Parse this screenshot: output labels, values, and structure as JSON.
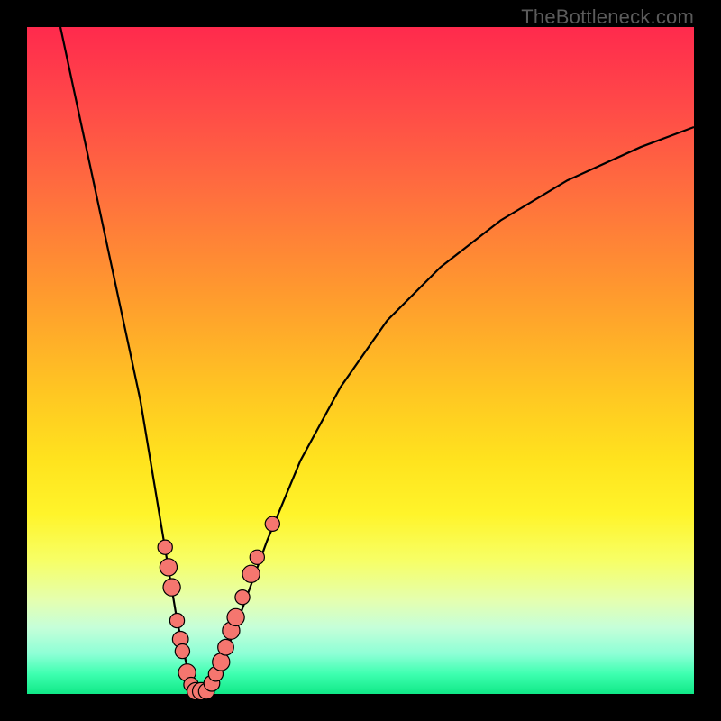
{
  "watermark": "TheBottleneck.com",
  "chart_data": {
    "type": "line",
    "title": "",
    "xlabel": "",
    "ylabel": "",
    "xlim": [
      0,
      100
    ],
    "ylim": [
      0,
      100
    ],
    "series": [
      {
        "name": "bottleneck-curve",
        "x": [
          5,
          8,
          11,
          14,
          17,
          19,
          21,
          22.5,
          24,
          25.5,
          27,
          29,
          32,
          36,
          41,
          47,
          54,
          62,
          71,
          81,
          92,
          100
        ],
        "y": [
          100,
          86,
          72,
          58,
          44,
          32,
          20,
          11,
          4,
          0.5,
          0.5,
          4,
          12,
          23,
          35,
          46,
          56,
          64,
          71,
          77,
          82,
          85
        ]
      }
    ],
    "markers": {
      "name": "data-points",
      "points": [
        {
          "x": 20.7,
          "y": 22.0,
          "r": 1.1
        },
        {
          "x": 21.2,
          "y": 19.0,
          "r": 1.5
        },
        {
          "x": 21.7,
          "y": 16.0,
          "r": 1.5
        },
        {
          "x": 22.5,
          "y": 11.0,
          "r": 1.1
        },
        {
          "x": 23.0,
          "y": 8.2,
          "r": 1.3
        },
        {
          "x": 23.3,
          "y": 6.4,
          "r": 1.1
        },
        {
          "x": 24.0,
          "y": 3.2,
          "r": 1.5
        },
        {
          "x": 24.6,
          "y": 1.4,
          "r": 1.1
        },
        {
          "x": 25.3,
          "y": 0.4,
          "r": 1.5
        },
        {
          "x": 26.1,
          "y": 0.4,
          "r": 1.5
        },
        {
          "x": 26.9,
          "y": 0.4,
          "r": 1.3
        },
        {
          "x": 27.7,
          "y": 1.6,
          "r": 1.3
        },
        {
          "x": 28.3,
          "y": 3.0,
          "r": 1.1
        },
        {
          "x": 29.1,
          "y": 4.8,
          "r": 1.5
        },
        {
          "x": 29.8,
          "y": 7.0,
          "r": 1.3
        },
        {
          "x": 30.6,
          "y": 9.5,
          "r": 1.5
        },
        {
          "x": 31.3,
          "y": 11.5,
          "r": 1.5
        },
        {
          "x": 32.3,
          "y": 14.5,
          "r": 1.1
        },
        {
          "x": 33.6,
          "y": 18.0,
          "r": 1.5
        },
        {
          "x": 34.5,
          "y": 20.5,
          "r": 1.1
        },
        {
          "x": 36.8,
          "y": 25.5,
          "r": 1.1
        }
      ],
      "fill": "#f5766f",
      "stroke": "#000000"
    }
  }
}
